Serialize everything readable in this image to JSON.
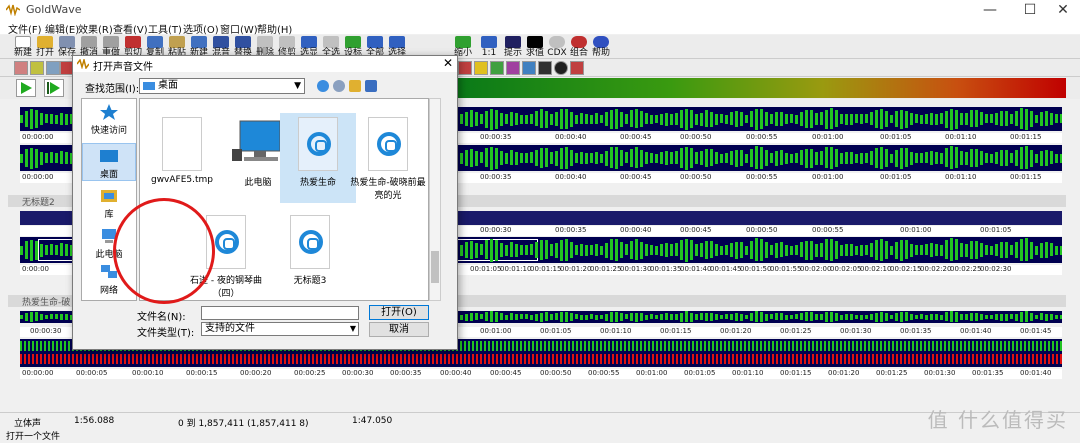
{
  "window": {
    "title": "GoldWave",
    "minimize": "—",
    "maximize": "☐",
    "close": "✕"
  },
  "menu": [
    "文件(F)",
    "编辑(E)",
    "效果(R)",
    "查看(V)",
    "工具(T)",
    "选项(O)",
    "窗口(W)",
    "帮助(H)"
  ],
  "toolbar": [
    "新建",
    "打开",
    "保存",
    "撤消",
    "重做",
    "剪切",
    "复制",
    "粘贴",
    "新建",
    "混音",
    "替换",
    "删除",
    "修剪",
    "选显",
    "全选",
    "设标",
    "全部",
    "选择",
    "缩小",
    "1:1",
    "提示",
    "求值",
    "CDX",
    "组合",
    "帮助"
  ],
  "dialog": {
    "title": "打开声音文件",
    "close": "✕",
    "look_in_label": "查找范围(I):",
    "look_in_value": "桌面",
    "places": [
      "快速访问",
      "桌面",
      "库",
      "此电脑",
      "网络"
    ],
    "files": [
      "gwvAFE5.tmp",
      "此电脑",
      "热爱生命",
      "热爱生命-破晓前最亮的光",
      "石进 - 夜的钢琴曲（四）",
      "无标题3"
    ],
    "filename_label": "文件名(N):",
    "filename_value": "",
    "filetype_label": "文件类型(T):",
    "filetype_value": "支持的文件",
    "open_button": "打开(O)",
    "cancel_button": "取消"
  },
  "tracks": {
    "titles": [
      "无标题2",
      "热爱生命-破"
    ],
    "ruler1": [
      "00:00:00",
      "00:00:35",
      "00:00:40",
      "00:00:45",
      "00:00:50",
      "00:00:55",
      "00:01:00",
      "00:01:05",
      "00:01:10",
      "00:01:15"
    ],
    "ruler1b": [
      "00:00:00",
      "00:00:35",
      "00:00:40",
      "00:00:45",
      "00:00:50",
      "00:00:55",
      "00:01:00",
      "00:01:05",
      "00:01:10",
      "00:01:15"
    ],
    "ruler2": [
      "00:00:30",
      "00:00:35",
      "00:00:40",
      "00:00:45",
      "00:00:50",
      "00:00:55",
      "00:01:00",
      "00:01:05"
    ],
    "ruler2b": [
      "0:00:00",
      "00:01:05",
      "00:01:10",
      "00:01:15",
      "00:01:20",
      "00:01:25",
      "00:01:30",
      "00:01:35",
      "00:01:40",
      "00:01:45",
      "00:01:50",
      "00:01:55",
      "00:02:00",
      "00:02:05",
      "00:02:10",
      "00:02:15",
      "00:02:20",
      "00:02:25",
      "00:02:30"
    ],
    "ruler3": [
      "00:00:30",
      "00:01:00",
      "00:01:05",
      "00:01:10",
      "00:01:15",
      "00:01:20",
      "00:01:25",
      "00:01:30",
      "00:01:35",
      "00:01:40",
      "00:01:45"
    ],
    "ruler3b": [
      "00:00:00",
      "00:00:05",
      "00:00:10",
      "00:00:15",
      "00:00:20",
      "00:00:25",
      "00:00:30",
      "00:00:35",
      "00:00:40",
      "00:00:45",
      "00:00:50",
      "00:00:55",
      "00:01:00",
      "00:01:05",
      "00:01:10",
      "00:01:15",
      "00:01:20",
      "00:01:25",
      "00:01:30",
      "00:01:35",
      "00:01:40",
      "00:01:45"
    ]
  },
  "status": {
    "channel": "立体声",
    "length": "1:56.088",
    "selection": "0 到 1,857,411 (1,857,411 8)",
    "position": "1:47.050",
    "hint": "打开一个文件"
  },
  "watermark": "值 什么值得买",
  "colors": {
    "wave_green": "#22c422",
    "wave_red": "#e01010",
    "wave_bg": "#000050",
    "highlight_circle": "#e01a1a"
  }
}
